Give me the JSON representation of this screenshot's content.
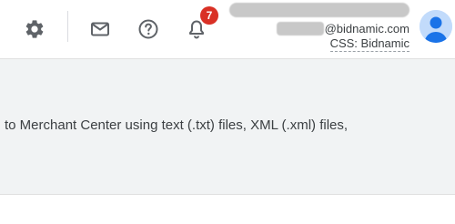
{
  "header": {
    "icons": {
      "settings": "gear-icon",
      "mail": "mail-icon",
      "help": "help-icon",
      "notifications": "bell-icon"
    },
    "notification_count": "7",
    "account": {
      "email_domain": "@bidnamic.com",
      "css_label": "CSS: Bidnamic"
    }
  },
  "main": {
    "text": "to Merchant Center using text (.txt) files, XML (.xml) files,"
  },
  "colors": {
    "badge": "#d93025",
    "avatar_bg": "#c2dbfb",
    "avatar_fg": "#1a73e8",
    "content_bg": "#f1f3f4"
  }
}
